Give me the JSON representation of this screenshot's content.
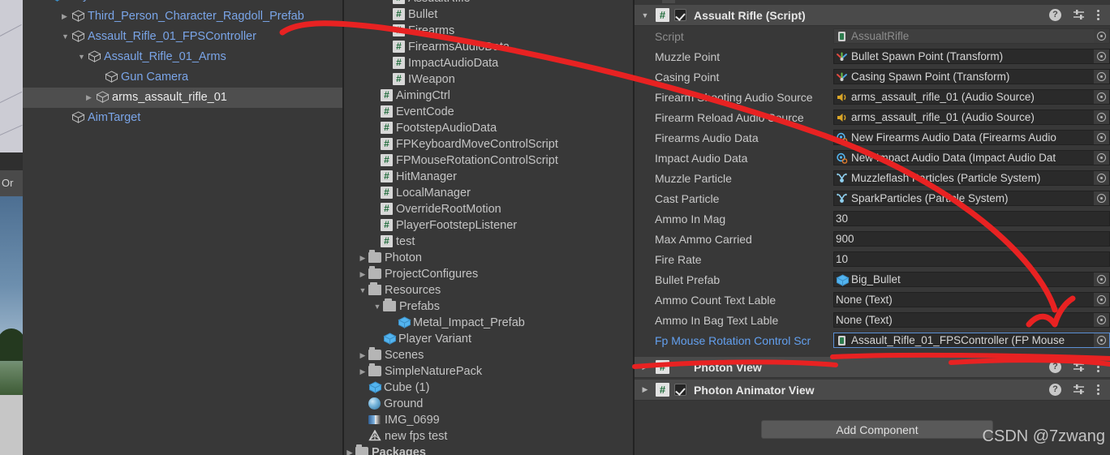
{
  "window": {
    "scene_strip_label": "Or"
  },
  "hierarchy": {
    "name": "hierarchy-panel",
    "items": [
      {
        "label": "Player Variant",
        "indent": 36,
        "arrow": "down",
        "style": "clipped",
        "icon": "prefab-cube-icon",
        "selected": false
      },
      {
        "label": "Third_Person_Character_Ragdoll_Prefab",
        "indent": 62,
        "arrow": "right",
        "style": "link",
        "icon": "gameobject-cube-icon",
        "selected": false
      },
      {
        "label": "Assault_Rifle_01_FPSController",
        "indent": 62,
        "arrow": "down",
        "style": "link",
        "icon": "gameobject-cube-icon",
        "selected": false
      },
      {
        "label": "Assault_Rifle_01_Arms",
        "indent": 82,
        "arrow": "down",
        "style": "link",
        "icon": "gameobject-cube-icon",
        "selected": false
      },
      {
        "label": "Gun Camera",
        "indent": 103,
        "arrow": "none",
        "style": "link",
        "icon": "gameobject-cube-icon",
        "selected": false
      },
      {
        "label": "arms_assault_rifle_01",
        "indent": 92,
        "arrow": "right",
        "style": "selected",
        "icon": "gameobject-cube-icon",
        "selected": true
      },
      {
        "label": "AimTarget",
        "indent": 62,
        "arrow": "none",
        "style": "link",
        "icon": "gameobject-cube-icon",
        "selected": false
      }
    ]
  },
  "project": {
    "name": "project-panel",
    "items": [
      {
        "label": "AssualtRifle",
        "indent": 60,
        "arrow": "none",
        "icon": "csharp-script-icon",
        "clipped": true
      },
      {
        "label": "Bullet",
        "indent": 60,
        "arrow": "none",
        "icon": "csharp-script-icon"
      },
      {
        "label": "Firearms",
        "indent": 60,
        "arrow": "none",
        "icon": "csharp-script-icon"
      },
      {
        "label": "FirearmsAudioData",
        "indent": 60,
        "arrow": "none",
        "icon": "csharp-script-icon"
      },
      {
        "label": "ImpactAudioData",
        "indent": 60,
        "arrow": "none",
        "icon": "csharp-script-icon"
      },
      {
        "label": "IWeapon",
        "indent": 60,
        "arrow": "none",
        "icon": "csharp-script-icon"
      },
      {
        "label": "AimingCtrl",
        "indent": 45,
        "arrow": "none",
        "icon": "csharp-script-icon"
      },
      {
        "label": "EventCode",
        "indent": 45,
        "arrow": "none",
        "icon": "csharp-script-icon"
      },
      {
        "label": "FootstepAudioData",
        "indent": 45,
        "arrow": "none",
        "icon": "csharp-script-icon"
      },
      {
        "label": "FPKeyboardMoveControlScript",
        "indent": 45,
        "arrow": "none",
        "icon": "csharp-script-icon"
      },
      {
        "label": "FPMouseRotationControlScript",
        "indent": 45,
        "arrow": "none",
        "icon": "csharp-script-icon"
      },
      {
        "label": "HitManager",
        "indent": 45,
        "arrow": "none",
        "icon": "csharp-script-icon"
      },
      {
        "label": "LocalManager",
        "indent": 45,
        "arrow": "none",
        "icon": "csharp-script-icon"
      },
      {
        "label": "OverrideRootMotion",
        "indent": 45,
        "arrow": "none",
        "icon": "csharp-script-icon"
      },
      {
        "label": "PlayerFootstepListener",
        "indent": 45,
        "arrow": "none",
        "icon": "csharp-script-icon"
      },
      {
        "label": "test",
        "indent": 45,
        "arrow": "none",
        "icon": "csharp-script-icon"
      },
      {
        "label": "Photon",
        "indent": 30,
        "arrow": "right",
        "icon": "folder-icon"
      },
      {
        "label": "ProjectConfigures",
        "indent": 30,
        "arrow": "right",
        "icon": "folder-icon"
      },
      {
        "label": "Resources",
        "indent": 30,
        "arrow": "down",
        "icon": "folder-open-icon"
      },
      {
        "label": "Prefabs",
        "indent": 48,
        "arrow": "down",
        "icon": "folder-open-icon"
      },
      {
        "label": "Metal_Impact_Prefab",
        "indent": 66,
        "arrow": "none",
        "icon": "prefab-cube-icon"
      },
      {
        "label": "Player Variant",
        "indent": 48,
        "arrow": "none",
        "icon": "prefab-cube-icon"
      },
      {
        "label": "Scenes",
        "indent": 30,
        "arrow": "right",
        "icon": "folder-icon"
      },
      {
        "label": "SimpleNaturePack",
        "indent": 30,
        "arrow": "right",
        "icon": "folder-icon"
      },
      {
        "label": "Cube (1)",
        "indent": 30,
        "arrow": "none",
        "icon": "prefab-cube-icon"
      },
      {
        "label": "Ground",
        "indent": 30,
        "arrow": "none",
        "icon": "sphere-mesh-icon"
      },
      {
        "label": "IMG_0699",
        "indent": 30,
        "arrow": "none",
        "icon": "image-texture-icon"
      },
      {
        "label": "new fps test",
        "indent": 30,
        "arrow": "none",
        "icon": "unity-scene-icon"
      },
      {
        "label": "Packages",
        "indent": 14,
        "arrow": "right",
        "icon": "folder-icon",
        "clipped": true
      }
    ]
  },
  "inspector": {
    "name": "inspector-panel",
    "components": [
      {
        "title": "Assualt Rifle (Script)",
        "expanded": true,
        "enabled": true,
        "has_checkbox": true
      }
    ],
    "properties": [
      {
        "label": "Script",
        "value": "AssualtRifle",
        "icon": "script-asset-icon",
        "readonly": true,
        "picker": true,
        "highlight": false
      },
      {
        "label": "Muzzle Point",
        "value": "Bullet Spawn Point (Transform)",
        "icon": "transform-icon",
        "readonly": false,
        "picker": true,
        "highlight": false
      },
      {
        "label": "Casing Point",
        "value": "Casing Spawn Point (Transform)",
        "icon": "transform-icon",
        "readonly": false,
        "picker": true,
        "highlight": false
      },
      {
        "label": "Firearm Shooting Audio Source",
        "value": "arms_assault_rifle_01 (Audio Source)",
        "icon": "audio-source-icon",
        "readonly": false,
        "picker": true,
        "highlight": false
      },
      {
        "label": "Firearm Reload Audio Source",
        "value": "arms_assault_rifle_01 (Audio Source)",
        "icon": "audio-source-icon",
        "readonly": false,
        "picker": true,
        "highlight": false
      },
      {
        "label": "Firearms Audio Data",
        "value": "New Firearms Audio Data (Firearms Audio",
        "icon": "scriptable-object-icon",
        "readonly": false,
        "picker": true,
        "highlight": false
      },
      {
        "label": "Impact Audio Data",
        "value": "New Impact Audio Data (Impact Audio Dat",
        "icon": "scriptable-object-icon",
        "readonly": false,
        "picker": true,
        "highlight": false
      },
      {
        "label": "Muzzle Particle",
        "value": "Muzzleflash Particles (Particle System)",
        "icon": "particle-system-icon",
        "readonly": false,
        "picker": true,
        "highlight": false
      },
      {
        "label": "Cast Particle",
        "value": "SparkParticles (Particle System)",
        "icon": "particle-system-icon",
        "readonly": false,
        "picker": true,
        "highlight": false
      },
      {
        "label": "Ammo In Mag",
        "value": "30",
        "icon": "none",
        "readonly": false,
        "picker": false,
        "highlight": false
      },
      {
        "label": "Max Ammo Carried",
        "value": "900",
        "icon": "none",
        "readonly": false,
        "picker": false,
        "highlight": false
      },
      {
        "label": "Fire Rate",
        "value": "10",
        "icon": "none",
        "readonly": false,
        "picker": false,
        "highlight": false
      },
      {
        "label": "Bullet Prefab",
        "value": "Big_Bullet",
        "icon": "prefab-cube-icon",
        "readonly": false,
        "picker": true,
        "highlight": false
      },
      {
        "label": "Ammo Count Text Lable",
        "value": "None (Text)",
        "icon": "none",
        "readonly": false,
        "picker": true,
        "highlight": false
      },
      {
        "label": "Ammo In Bag Text Lable",
        "value": "None (Text)",
        "icon": "none",
        "readonly": false,
        "picker": true,
        "highlight": false
      },
      {
        "label": "Fp Mouse Rotation Control Scr",
        "value": "Assault_Rifle_01_FPSController (FP Mouse",
        "icon": "script-asset-icon",
        "readonly": false,
        "picker": true,
        "highlight": true,
        "selected": true
      }
    ],
    "extra_components": [
      {
        "title": "Photon View",
        "expanded": false,
        "has_checkbox": false,
        "enabled": false
      },
      {
        "title": "Photon Animator View",
        "expanded": false,
        "has_checkbox": true,
        "enabled": true
      }
    ],
    "add_component_label": "Add Component",
    "watermark": "CSDN @7zwang"
  },
  "colors": {
    "panel_bg": "#383838",
    "header_bg": "#4a4a4a",
    "field_bg": "#2a2a2a",
    "link_text": "#7aa5e8",
    "annotation_red": "#e82222",
    "selection_row": "#4e4e4e",
    "selected_field_border": "#5b8fd4"
  }
}
